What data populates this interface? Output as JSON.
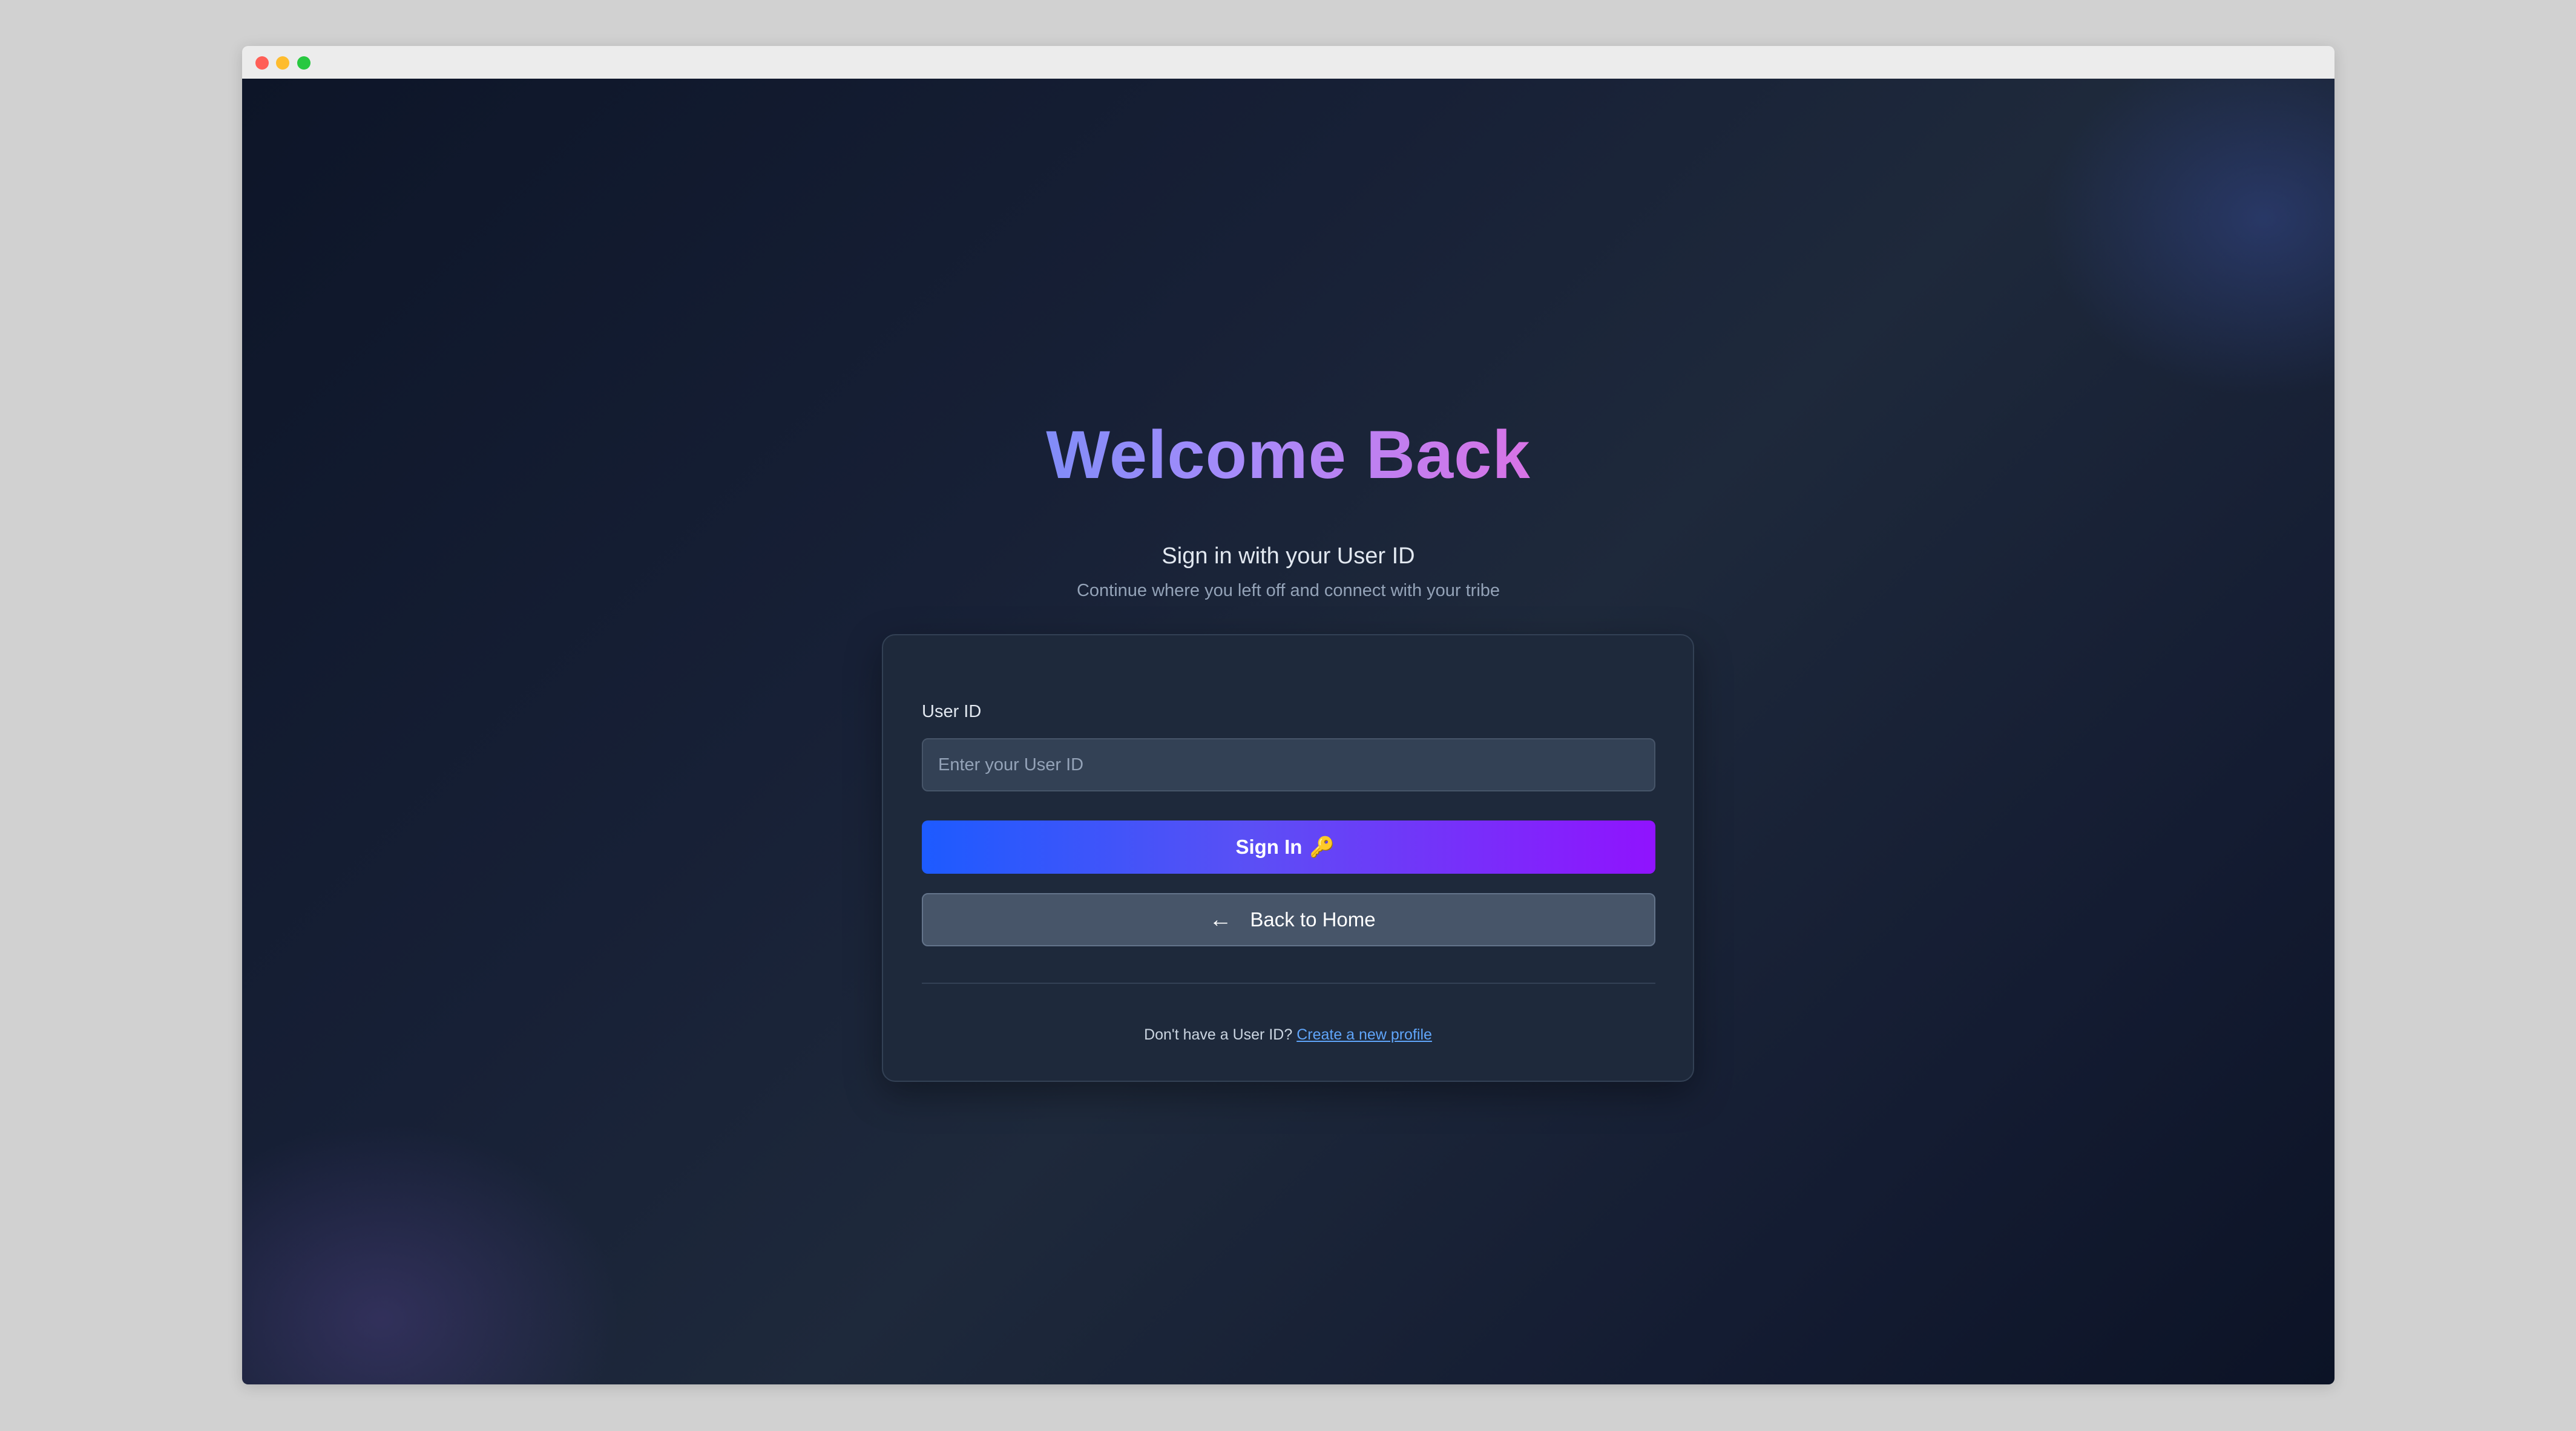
{
  "window": {
    "controls": [
      "close",
      "minimize",
      "maximize"
    ]
  },
  "header": {
    "title": "Welcome Back",
    "subtitle": "Sign in with your User ID",
    "tagline": "Continue where you left off and connect with your tribe"
  },
  "form": {
    "user_id_label": "User ID",
    "user_id_value": "",
    "user_id_placeholder": "Enter your User ID",
    "sign_in_label": "Sign In",
    "sign_in_icon": "🔑",
    "back_label": "Back to Home",
    "back_icon": "←"
  },
  "footer": {
    "prompt": "Don't have a User ID?",
    "link_label": "Create a new profile"
  },
  "colors": {
    "accent_start": "#1d5bff",
    "accent_end": "#9013fe",
    "link": "#60a5fa",
    "card_bg": "#1e293b"
  }
}
